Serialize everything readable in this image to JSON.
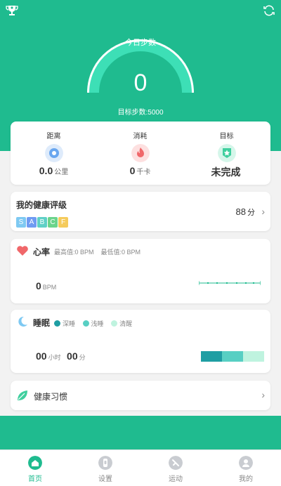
{
  "gauge": {
    "title": "今日步数",
    "value": "0",
    "goal_label": "目标步数:5000"
  },
  "stats": [
    {
      "label": "距离",
      "value": "0.0",
      "unit": "公里",
      "icon": "location-icon",
      "color": "#6aa7ef"
    },
    {
      "label": "消耗",
      "value": "0",
      "unit": "千卡",
      "icon": "fire-icon",
      "color": "#f0676a"
    },
    {
      "label": "目标",
      "value": "未完成",
      "unit": "",
      "icon": "star-badge-icon",
      "color": "#3fcf9e"
    }
  ],
  "health": {
    "title": "我的健康评级",
    "grades": [
      {
        "letter": "S",
        "color": "#7ec9f2"
      },
      {
        "letter": "A",
        "color": "#6f9bf2"
      },
      {
        "letter": "B",
        "color": "#5fd0c6"
      },
      {
        "letter": "C",
        "color": "#6bd48b"
      },
      {
        "letter": "F",
        "color": "#f5cb5c"
      }
    ],
    "score": "88",
    "score_unit": "分"
  },
  "heart": {
    "title": "心率",
    "max_label": "最高值:0  BPM",
    "min_label": "最低值:0  BPM",
    "value": "0",
    "unit": "BPM"
  },
  "sleep": {
    "title": "睡眠",
    "legend": [
      {
        "label": "深睡",
        "color": "#1f9ea3"
      },
      {
        "label": "浅睡",
        "color": "#58cfc3"
      },
      {
        "label": "清醒",
        "color": "#bff3df"
      }
    ],
    "hours": "00",
    "hours_unit": "小时",
    "minutes": "00",
    "minutes_unit": "分"
  },
  "habit": {
    "title": "健康习惯"
  },
  "tabs": [
    {
      "label": "首页",
      "icon": "home-icon",
      "active": true
    },
    {
      "label": "设置",
      "icon": "watch-icon",
      "active": false
    },
    {
      "label": "运动",
      "icon": "run-icon",
      "active": false
    },
    {
      "label": "我的",
      "icon": "profile-icon",
      "active": false
    }
  ],
  "colors": {
    "primary": "#1fbb8f",
    "gauge_arc": "#3ddfb6"
  }
}
